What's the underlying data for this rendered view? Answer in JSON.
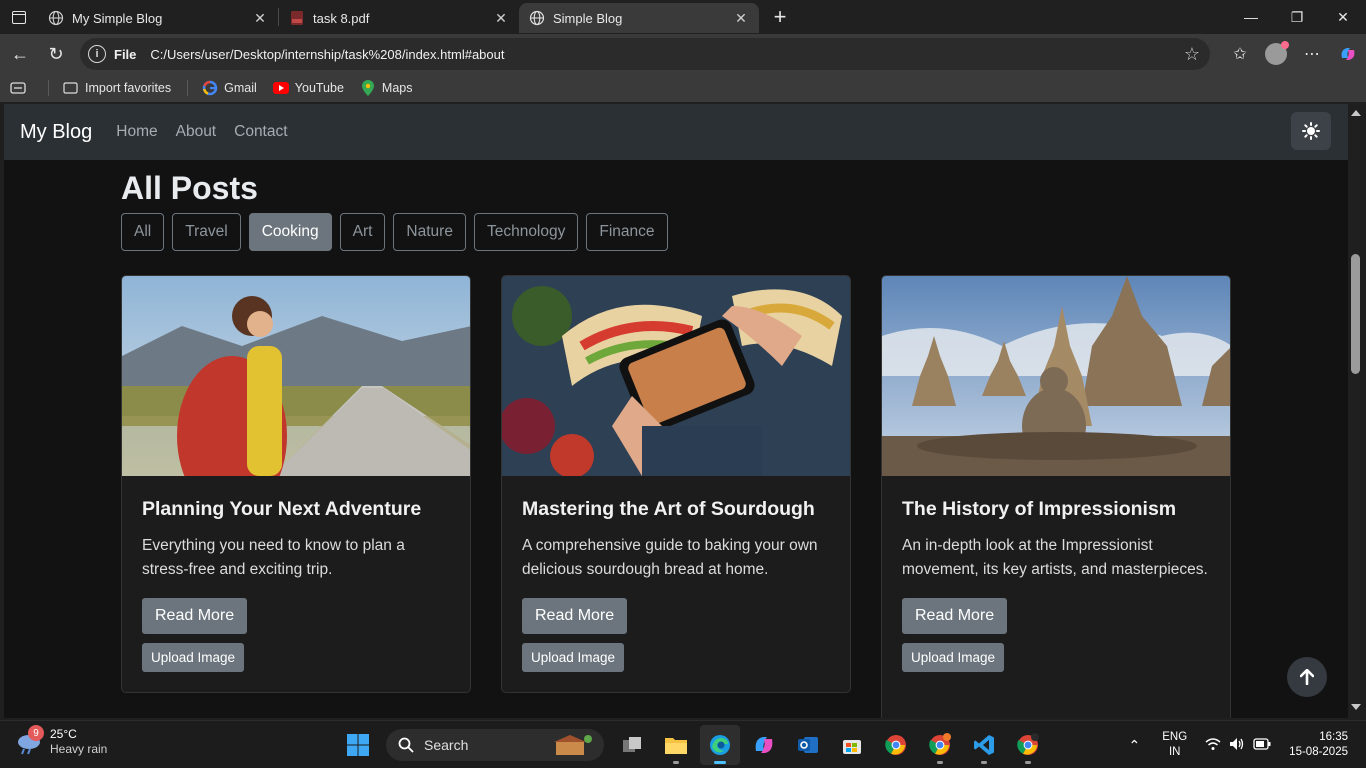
{
  "browser": {
    "tabs": [
      {
        "title": "My Simple Blog",
        "active": false
      },
      {
        "title": "task 8.pdf",
        "active": false
      },
      {
        "title": "Simple Blog",
        "active": true
      }
    ],
    "address": {
      "scheme_label": "File",
      "url": "C:/Users/user/Desktop/internship/task%208/index.html#about"
    },
    "bookmarks": [
      {
        "label": "Import favorites"
      },
      {
        "label": "Gmail"
      },
      {
        "label": "YouTube"
      },
      {
        "label": "Maps"
      }
    ]
  },
  "page": {
    "brand": "My Blog",
    "nav": [
      "Home",
      "About",
      "Contact"
    ],
    "heading": "All Posts",
    "filters": [
      {
        "label": "All",
        "active": false
      },
      {
        "label": "Travel",
        "active": false
      },
      {
        "label": "Cooking",
        "active": true
      },
      {
        "label": "Art",
        "active": false
      },
      {
        "label": "Nature",
        "active": false
      },
      {
        "label": "Technology",
        "active": false
      },
      {
        "label": "Finance",
        "active": false
      }
    ],
    "posts": [
      {
        "title": "Planning Your Next Adventure",
        "desc": "Everything you need to know to plan a stress-free and exciting trip.",
        "read": "Read More",
        "upload": "Upload Image"
      },
      {
        "title": "Mastering the Art of Sourdough",
        "desc": "A comprehensive guide to baking your own delicious sourdough bread at home.",
        "read": "Read More",
        "upload": "Upload Image"
      },
      {
        "title": "The History of Impressionism",
        "desc": "An in-depth look at the Impressionist movement, its key artists, and masterpieces.",
        "read": "Read More",
        "upload": "Upload Image"
      }
    ]
  },
  "taskbar": {
    "weather": {
      "temp": "25°C",
      "condition": "Heavy rain",
      "badge": "9"
    },
    "search_label": "Search",
    "lang": {
      "line1": "ENG",
      "line2": "IN"
    },
    "clock": {
      "time": "16:35",
      "date": "15-08-2025"
    }
  },
  "colors": {
    "page_bg": "#121212",
    "navbar_bg": "#2b3035",
    "button_secondary": "#6c757d",
    "card_bg": "#1c1c1c"
  }
}
